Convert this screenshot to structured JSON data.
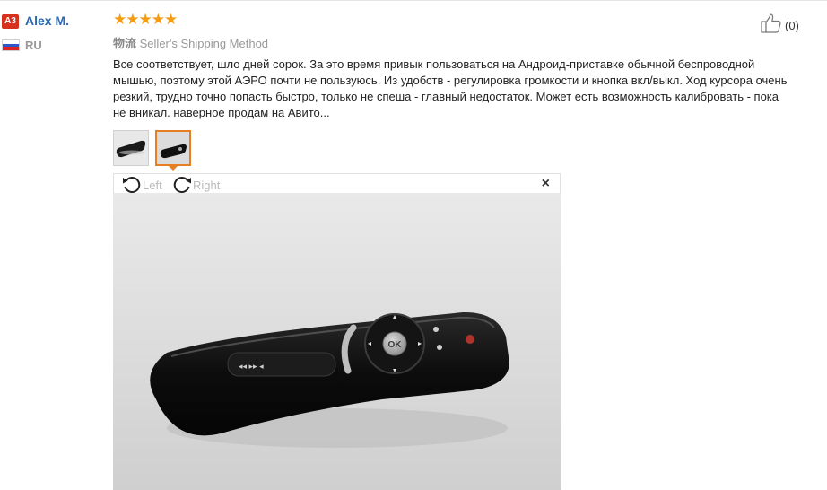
{
  "user": {
    "avatar_initials": "A3",
    "name": "Alex M.",
    "country": "RU",
    "flag_colors": [
      "#ffffff",
      "#2b57c7",
      "#d8232a"
    ]
  },
  "review": {
    "stars": "★★★★★",
    "rating": 5,
    "shipping_cn": "物流",
    "shipping_label": "Seller's Shipping Method",
    "text": "Все соответствует, шло дней сорок. За это время привык пользоваться на Андроид-приставке обычной беспроводной мышью, поэтому этой АЭРО почти не пользуюсь. Из удобств - регулировка громкости и кнопка вкл/выкл. Ход курсора очень резкий, трудно точно попасть быстро, только не спеша - главный недостаток. Может есть возможность калибровать - пока не вникал. наверное продам на Авито..."
  },
  "helpful": {
    "icon": "thumbs-up-icon",
    "count": "(0)"
  },
  "viewer": {
    "rotate_left_label": "Left",
    "rotate_right_label": "Right",
    "close_label": "×",
    "remote_button_label": "OK"
  },
  "colors": {
    "accent_orange": "#e67e22",
    "star_color": "#f39c12",
    "link_blue": "#2a68b2",
    "badge_red": "#d6301f"
  }
}
